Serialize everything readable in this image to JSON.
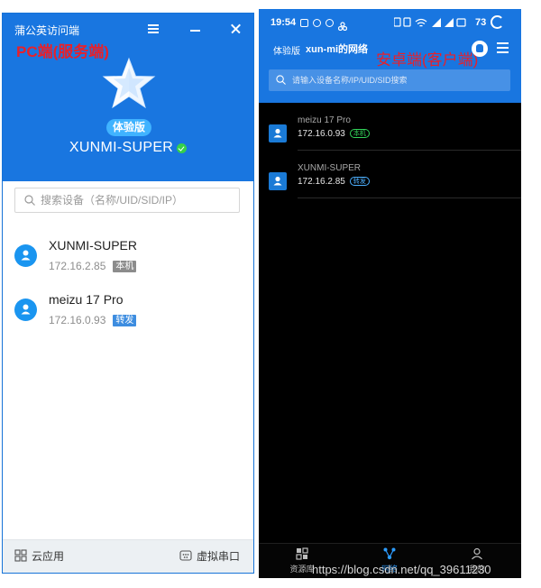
{
  "pc": {
    "window_title": "蒲公英访问端",
    "annotation": "PC端(服务端)",
    "edition_badge": "体验版",
    "hostname": "XUNMI-SUPER",
    "search": {
      "placeholder": "搜索设备（名称/UID/SID/IP）",
      "value": ""
    },
    "devices": [
      {
        "name": "XUNMI-SUPER",
        "ip": "172.16.2.85",
        "tag": "本机"
      },
      {
        "name": "meizu 17 Pro",
        "ip": "172.16.0.93",
        "tag": "转发"
      }
    ],
    "footer": {
      "cloud_apps": "云应用",
      "virtual_serial": "虚拟串口"
    },
    "colors": {
      "header": "#1976e0",
      "online": "#36d04b",
      "badge": "#40b3ff"
    }
  },
  "phone": {
    "status_bar": {
      "time": "19:54",
      "battery": "73"
    },
    "edition": "体验版",
    "network_name": "xun-mi的网络",
    "annotation": "安卓端(客户端)",
    "search": {
      "placeholder": "请输入设备名称/IP/UID/SID搜索",
      "value": ""
    },
    "devices": [
      {
        "name": "meizu 17 Pro",
        "ip": "172.16.0.93",
        "tag": "本机"
      },
      {
        "name": "XUNMI-SUPER",
        "ip": "172.16.2.85",
        "tag": "转发"
      }
    ],
    "nav": {
      "resources": "资源库",
      "network": "网络",
      "me": "我的"
    }
  },
  "watermark": "https://blog.csdn.net/qq_39611230"
}
